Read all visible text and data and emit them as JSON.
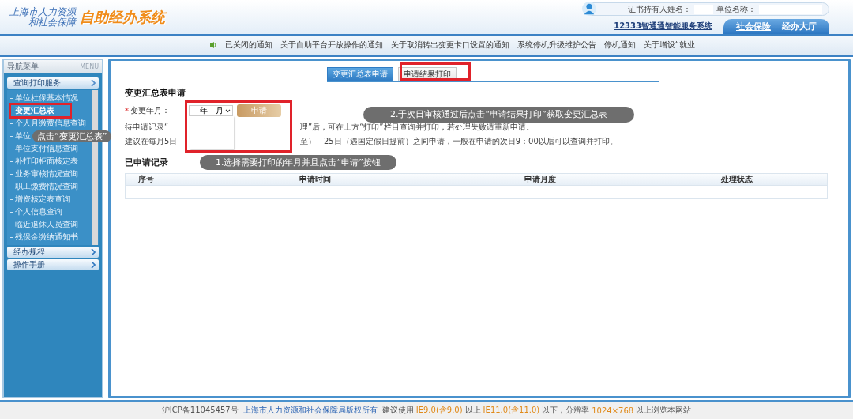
{
  "header": {
    "org_name": [
      "上海市人力资源",
      "和社会保障"
    ],
    "system_title": "自助经办系统",
    "user_labels": [
      "证书持有人姓名：",
      "单位名称："
    ],
    "service_link": "12333智通通智能服务系统",
    "nav_tabs": [
      {
        "label": "社会保险",
        "selected": true
      },
      {
        "label": "经办大厅",
        "selected": false
      }
    ]
  },
  "notices": [
    "已关闭的通知",
    "关于自助平台开放操作的通知",
    "关于取消转出变更卡口设置的通知",
    "系统停机升级维护公告",
    "停机通知",
    "关于增设“就业"
  ],
  "sidebar": {
    "title": "导航菜单",
    "menu_label": "MENU",
    "groups": [
      {
        "label": "查询打印服务",
        "expanded": true,
        "children": [
          {
            "label": "单位社保基本情况",
            "selected": false
          },
          {
            "label": "变更汇总表",
            "selected": true
          },
          {
            "label": "个人月缴费信息查询",
            "selected": false
          },
          {
            "label": "单位",
            "selected": false
          },
          {
            "label": "单位支付信息查询",
            "selected": false
          },
          {
            "label": "补打印柜面核定表",
            "selected": false
          },
          {
            "label": "业务审核情况查询",
            "selected": false
          },
          {
            "label": "职工缴费情况查询",
            "selected": false
          },
          {
            "label": "增资核定表查询",
            "selected": false
          },
          {
            "label": "个人信息查询",
            "selected": false
          },
          {
            "label": "临近退休人员查询",
            "selected": false
          },
          {
            "label": "残保金缴纳通知书",
            "selected": false
          }
        ]
      },
      {
        "label": "经办规程",
        "expanded": false
      },
      {
        "label": "操作手册",
        "expanded": false
      }
    ]
  },
  "content": {
    "tabs": [
      {
        "label": "变更汇总表申请",
        "selected": true
      },
      {
        "label": "申请结果打印",
        "selected": false
      }
    ],
    "title": "变更汇总表申请",
    "required_mark": "*",
    "field_label": "变更年月：",
    "select_value": "年　月",
    "apply_button": "申请",
    "notes": [
      [
        "待申请记录“",
        "理”后，可在上方“打印”栏目查询并打印，若处理失败请重新申请。"
      ],
      [
        "建议在每月5日",
        "至）—25日（遇国定假日提前）之间申请，一般在申请的次日9：00以后可以查询并打印。"
      ]
    ],
    "records_title": "已申请记录",
    "columns": [
      "序号",
      "申请时间",
      "申请月度",
      "处理状态"
    ]
  },
  "annotations": [
    {
      "kind": "sidebar",
      "text": "点击“变更汇总表”"
    },
    {
      "kind": "step1",
      "text": "1.选择需要打印的年月并且点击“申请”按钮"
    },
    {
      "kind": "step2",
      "text": "2.于次日审核通过后点击“申请结果打印”获取变更汇总表"
    }
  ],
  "footer": [
    {
      "kind": "plain",
      "text": "沪ICP备11045457号"
    },
    {
      "kind": "link",
      "text": "上海市人力资源和社会保障局版权所有"
    },
    {
      "kind": "plain",
      "text": "建议使用"
    },
    {
      "kind": "highlight",
      "text": "IE9.0(含9.0)"
    },
    {
      "kind": "plain",
      "text": "以上"
    },
    {
      "kind": "highlight",
      "text": "IE11.0(含11.0)"
    },
    {
      "kind": "plain",
      "text": "以下，分辨率"
    },
    {
      "kind": "highlight",
      "text": "1024×768"
    },
    {
      "kind": "plain",
      "text": "以上浏览本网站"
    }
  ]
}
